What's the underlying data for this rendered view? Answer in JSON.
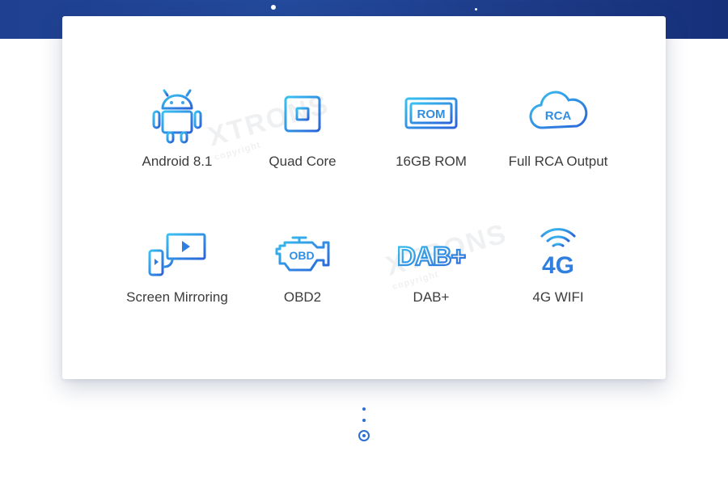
{
  "features": [
    {
      "label": "Android 8.1",
      "icon": "android-icon"
    },
    {
      "label": "Quad Core",
      "icon": "cpu-chip-icon",
      "icon_text": ""
    },
    {
      "label": "16GB ROM",
      "icon": "rom-chip-icon",
      "icon_text": "ROM"
    },
    {
      "label": "Full RCA Output",
      "icon": "rca-cloud-icon",
      "icon_text": "RCA"
    },
    {
      "label": "Screen Mirroring",
      "icon": "screen-mirroring-icon"
    },
    {
      "label": "OBD2",
      "icon": "obd-engine-icon",
      "icon_text": "OBD"
    },
    {
      "label": "DAB+",
      "icon": "dab-plus-icon",
      "icon_text": "DAB+"
    },
    {
      "label": "4G WIFI",
      "icon": "4g-signal-icon",
      "icon_text": "4G"
    }
  ],
  "watermark": {
    "brand": "XTRONS",
    "sub": "copyright"
  },
  "colors": {
    "accent": "#2a6fd6",
    "icon_gradient_start": "#39c2f0",
    "icon_gradient_end": "#2b63d9",
    "header_band": "#1f3f8f"
  }
}
